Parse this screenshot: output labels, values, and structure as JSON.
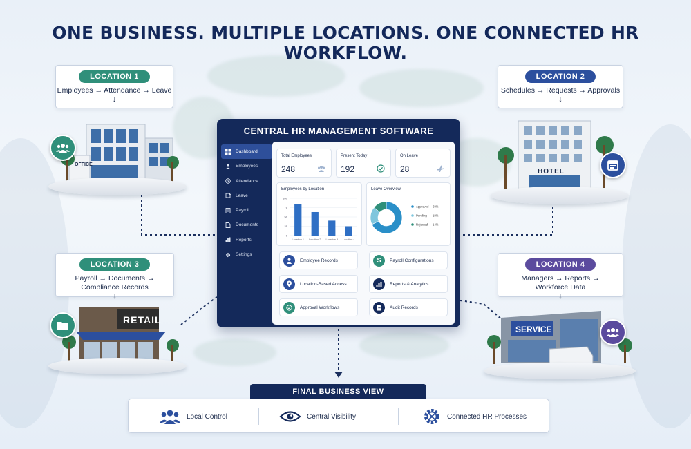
{
  "title": "ONE BUSINESS. MULTIPLE LOCATIONS. ONE CONNECTED HR WORKFLOW.",
  "colors": {
    "navy": "#14295a",
    "green": "#2f8f7a",
    "blue": "#2c4f9e",
    "purple": "#5b4b9e"
  },
  "locations": [
    {
      "name": "LOCATION 1",
      "text": "Employees → Attendance → Leave",
      "text2": "",
      "arrow": "↓",
      "building": "OFFICE",
      "icon": "users-icon"
    },
    {
      "name": "LOCATION 2",
      "text": "Schedules → Requests → Approvals",
      "text2": "",
      "arrow": "↓",
      "building": "HOTEL",
      "icon": "calendar-icon"
    },
    {
      "name": "LOCATION 3",
      "text": "Payroll → Documents →",
      "text2": "Compliance Records",
      "arrow": "↓",
      "building": "RETAIL",
      "icon": "folder-icon"
    },
    {
      "name": "LOCATION 4",
      "text": "Managers → Reports →",
      "text2": "Workforce Data",
      "arrow": "↓",
      "building": "SERVICE",
      "icon": "team-icon"
    }
  ],
  "central": {
    "title": "CENTRAL HR MANAGEMENT SOFTWARE",
    "nav": [
      {
        "label": "Dashboard",
        "icon": "dashboard-icon"
      },
      {
        "label": "Employees",
        "icon": "employees-icon"
      },
      {
        "label": "Attendance",
        "icon": "clock-icon"
      },
      {
        "label": "Leave",
        "icon": "leave-icon"
      },
      {
        "label": "Payroll",
        "icon": "payroll-icon"
      },
      {
        "label": "Documents",
        "icon": "documents-icon"
      },
      {
        "label": "Reports",
        "icon": "reports-icon"
      },
      {
        "label": "Settings",
        "icon": "settings-icon"
      }
    ],
    "stats": [
      {
        "label": "Total Employees",
        "value": "248",
        "icon": "users-icon"
      },
      {
        "label": "Present Today",
        "value": "192",
        "icon": "check-circle-icon"
      },
      {
        "label": "On Leave",
        "value": "28",
        "icon": "plane-icon"
      }
    ],
    "features": [
      {
        "label": "Employee Records",
        "icon": "person-icon"
      },
      {
        "label": "Payroll Configurations",
        "icon": "dollar-icon"
      },
      {
        "label": "Location-Based Access",
        "icon": "pin-icon"
      },
      {
        "label": "Reports & Analytics",
        "icon": "bar-chart-icon"
      },
      {
        "label": "Approval Workflows",
        "icon": "check-icon"
      },
      {
        "label": "Audit Records",
        "icon": "document-icon"
      }
    ]
  },
  "chart_data": [
    {
      "type": "bar",
      "title": "Employees by Location",
      "categories": [
        "Location 1",
        "Location 2",
        "Location 3",
        "Location 4"
      ],
      "values": [
        85,
        63,
        40,
        25
      ],
      "yticks": [
        "100",
        "75",
        "50",
        "25",
        "0"
      ],
      "ylim": [
        0,
        100
      ],
      "grid": true
    },
    {
      "type": "pie",
      "title": "Leave Overview",
      "donut": true,
      "labels": [
        "Approved",
        "Pending",
        "Rejected"
      ],
      "values": [
        68,
        18,
        14
      ],
      "value_labels": [
        "68%",
        "18%",
        "14%"
      ],
      "colors": [
        "#2a8fc8",
        "#7fc6dd",
        "#2f8f7a"
      ],
      "legend": "right"
    }
  ],
  "final": {
    "title": "FINAL BUSINESS VIEW",
    "items": [
      {
        "label": "Local Control",
        "icon": "people-icon"
      },
      {
        "label": "Central Visibility",
        "icon": "eye-icon"
      },
      {
        "label": "Connected HR Processes",
        "icon": "network-gear-icon"
      }
    ]
  }
}
